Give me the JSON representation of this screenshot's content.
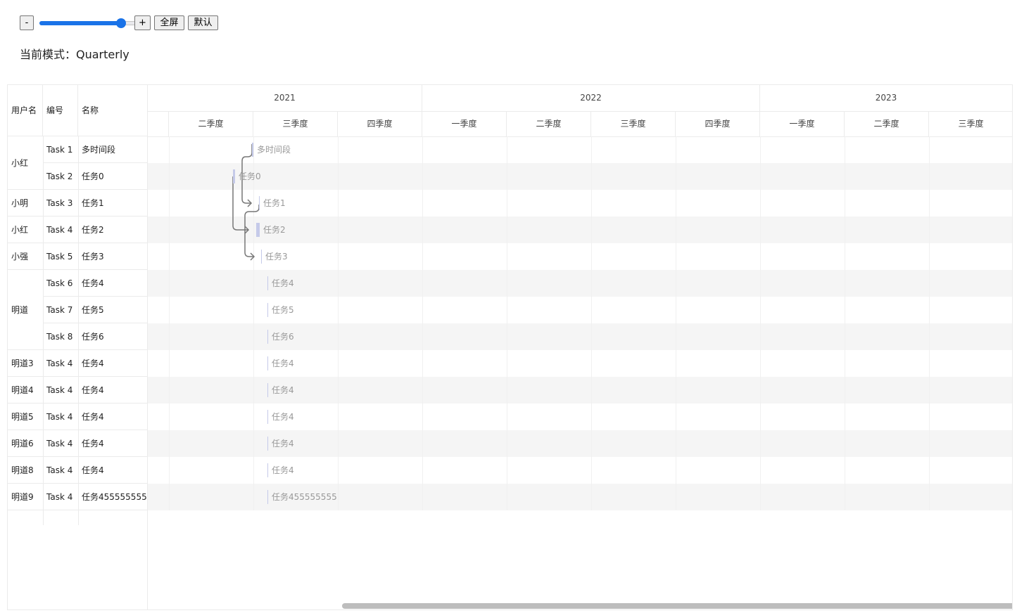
{
  "toolbar": {
    "minus_label": "-",
    "plus_label": "+",
    "fullscreen_label": "全屏",
    "default_label": "默认",
    "zoom_level": 0.75
  },
  "mode_text": "当前模式：Quarterly",
  "table": {
    "headers": [
      "用户名",
      "编号",
      "名称"
    ],
    "user_groups": [
      {
        "name": "小红",
        "rows": 2
      },
      {
        "name": "小明",
        "rows": 1
      },
      {
        "name": "小红",
        "rows": 1
      },
      {
        "name": "小强",
        "rows": 1
      },
      {
        "name": "明道",
        "rows": 3
      },
      {
        "name": "明道3",
        "rows": 1
      },
      {
        "name": "明道4",
        "rows": 1
      },
      {
        "name": "明道5",
        "rows": 1
      },
      {
        "name": "明道6",
        "rows": 1
      },
      {
        "name": "明道8",
        "rows": 1
      },
      {
        "name": "明道9",
        "rows": 1
      }
    ],
    "rows": [
      {
        "id": "Task 1",
        "name": "多时间段"
      },
      {
        "id": "Task 2",
        "name": "任务0"
      },
      {
        "id": "Task 3",
        "name": "任务1"
      },
      {
        "id": "Task 4",
        "name": "任务2"
      },
      {
        "id": "Task 5",
        "name": "任务3"
      },
      {
        "id": "Task 6",
        "name": "任务4"
      },
      {
        "id": "Task 7",
        "name": "任务5"
      },
      {
        "id": "Task 8",
        "name": "任务6"
      },
      {
        "id": "Task 4",
        "name": "任务4"
      },
      {
        "id": "Task 4",
        "name": "任务4"
      },
      {
        "id": "Task 4",
        "name": "任务4"
      },
      {
        "id": "Task 4",
        "name": "任务4"
      },
      {
        "id": "Task 4",
        "name": "任务4"
      },
      {
        "id": "Task 4",
        "name": "任务455555555"
      }
    ]
  },
  "timeline": {
    "years": [
      "2021",
      "2022",
      "2023"
    ],
    "quarters": [
      "二季度",
      "三季度",
      "四季度",
      "一季度",
      "二季度",
      "三季度",
      "四季度",
      "一季度",
      "二季度",
      "三季度"
    ]
  },
  "colors": {
    "bar": "#c5cae9",
    "stripe": "#f5f5f5",
    "grid": "#ebebeb",
    "link": "#777777",
    "slider": "#1a73e8",
    "scrollbar": "#bdbdbd"
  }
}
